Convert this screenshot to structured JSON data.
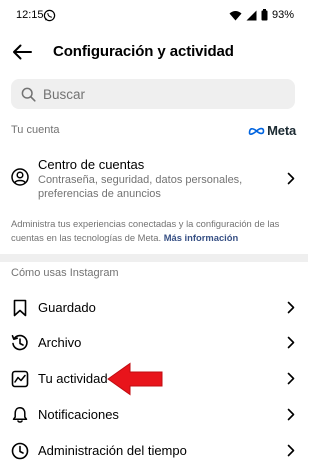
{
  "status_bar": {
    "time": "12:15",
    "battery": "93%"
  },
  "header": {
    "title": "Configuración y actividad"
  },
  "search": {
    "placeholder": "Buscar"
  },
  "your_account": {
    "section_label": "Tu cuenta",
    "meta_logo_text": "Meta",
    "accounts_center": {
      "title": "Centro de cuentas",
      "subtitle": "Contraseña, seguridad, datos personales, preferencias de anuncios"
    },
    "info_text": "Administra tus experiencias conectadas y la configuración de las cuentas en las tecnologías de Meta.",
    "info_link": "Más información"
  },
  "how_you_use": {
    "section_label": "Cómo usas Instagram",
    "items": [
      {
        "label": "Guardado",
        "icon": "bookmark-icon"
      },
      {
        "label": "Archivo",
        "icon": "archive-icon"
      },
      {
        "label": "Tu actividad",
        "icon": "activity-icon"
      },
      {
        "label": "Notificaciones",
        "icon": "bell-icon"
      },
      {
        "label": "Administración del tiempo",
        "icon": "clock-icon"
      }
    ]
  },
  "colors": {
    "annotation_arrow": "#e8141b",
    "link": "#385185",
    "secondary_text": "#737373"
  }
}
